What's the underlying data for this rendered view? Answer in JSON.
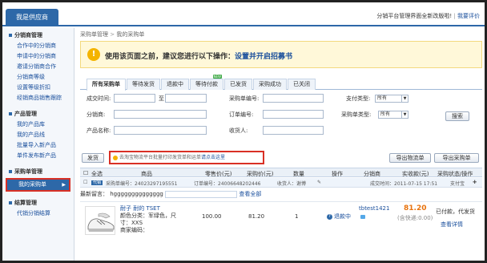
{
  "header": {
    "brand_tab": "我是供应商",
    "notice": "分销平台管理界面全新改版啦!",
    "feedback": "我要评价"
  },
  "sidebar": {
    "sections": [
      {
        "title": "分销商管理",
        "items": [
          "合作中的分销商",
          "申请中的分销商",
          "邀请分销商合作",
          "分销商等级",
          "设置等级折扣",
          "经销商品销售跟踪"
        ]
      },
      {
        "title": "产品管理",
        "items": [
          "我的产品库",
          "我的产品线",
          "批量导入新产品",
          "单件发布新产品"
        ]
      },
      {
        "title": "采购单管理",
        "items": [
          "我的采购单"
        ]
      },
      {
        "title": "结算管理",
        "items": [
          "代销分销结算"
        ]
      }
    ]
  },
  "breadcrumb": {
    "parent": "采购单管理",
    "sep": ">",
    "current": "我的采购单"
  },
  "tip": {
    "text": "使用该页面之前，建议您进行以下操作：",
    "link": "设置并开启招募书"
  },
  "tabs": [
    {
      "label": "所有采购单",
      "active": true
    },
    {
      "label": "等待发货"
    },
    {
      "label": "退款中"
    },
    {
      "label": "等待付款",
      "badge": "NEW"
    },
    {
      "label": "已发货"
    },
    {
      "label": "采购成功"
    },
    {
      "label": "已关闭"
    }
  ],
  "search": {
    "time_label": "成交时间:",
    "to_label": "至",
    "po_label": "采购单编号:",
    "pay_type_label": "支付类型:",
    "pay_type_value": "所有",
    "distributor_label": "分销商:",
    "order_no_label": "订单编号:",
    "po_type_label": "采购单类型:",
    "po_type_value": "所有",
    "search_button": "搜索",
    "product_label": "产品名称:",
    "receiver_label": "收货人:"
  },
  "actions": {
    "ship": "发货",
    "notice_text": "去淘宝物流平台批量打印发货单和运单",
    "notice_link": "请点击这里",
    "export_logistics": "导出物流单",
    "export_po": "导出采购单"
  },
  "table_header": {
    "select_all": "全选",
    "product": "商品",
    "cost_price": "零售价(元)",
    "purchase_price": "采购价(元)",
    "quantity": "数量",
    "operation": "操作",
    "distributor": "分销商",
    "paid": "实收款(元)",
    "status": "采购状态/操作"
  },
  "order": {
    "tag": "代销",
    "po_label": "采购单编号：",
    "po_no": "24023297195551",
    "order_label": "订单编号：",
    "order_no": "24006648202446",
    "receiver_label": "收货人：",
    "receiver": "谢博",
    "time_label": "成交时间：",
    "time": "2011-07-15 17:51",
    "status_tag": "支付宝",
    "remark_label": "最新留言：",
    "remark_value": "hgggggggggggggg",
    "view_all": "查看全部",
    "item": {
      "name": "耐子 耐的 TSET",
      "color": "颜色分类：军绿色，尺",
      "size": "寸：XXS",
      "merchant": "商家编码：",
      "retail": "100.00",
      "purchase": "81.20",
      "qty": "1",
      "refund": "退款中",
      "distributor": "tbtest1421",
      "paid": "81.20",
      "shipping": "(含快递:0.00)",
      "status": "已付款，代发货",
      "detail": "查看详情"
    }
  }
}
